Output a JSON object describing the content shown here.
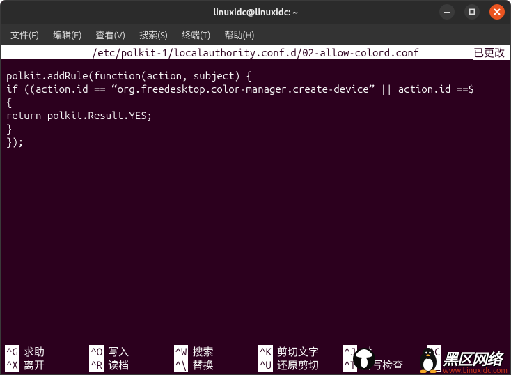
{
  "window": {
    "title": "linuxidc@linuxidc: ~"
  },
  "menubar": {
    "file": "文件(F)",
    "edit": "编辑(E)",
    "view": "查看(V)",
    "search": "搜索(S)",
    "terminal": "终端(T)",
    "help": "帮助(H)"
  },
  "nano": {
    "file_path": "/etc/polkit-1/localauthority.conf.d/02-allow-colord.conf",
    "status": "已更改"
  },
  "editor": {
    "content": "polkit.addRule(function(action, subject) {\nif ((action.id == “org.freedesktop.color-manager.create-device” || action.id ==$\n{\nreturn polkit.Result.YES;\n}\n});"
  },
  "shortcuts": {
    "g": {
      "key": "^G",
      "label": "求助"
    },
    "o": {
      "key": "^O",
      "label": "写入"
    },
    "w": {
      "key": "^W",
      "label": "搜索"
    },
    "k": {
      "key": "^K",
      "label": "剪切文字"
    },
    "j": {
      "key": "^J",
      "label": "对"
    },
    "c": {
      "key": "^C",
      "label": ""
    },
    "x": {
      "key": "^X",
      "label": "离开"
    },
    "r": {
      "key": "^R",
      "label": "读档"
    },
    "bs": {
      "key": "^\\",
      "label": "替换"
    },
    "u": {
      "key": "^U",
      "label": "还原剪切"
    },
    "t": {
      "key": "^T",
      "label": "拼写检查"
    },
    "und": {
      "key": "^_",
      "label": ""
    }
  },
  "watermark": {
    "brand1": "黑区",
    "brand2": "网络",
    "url": "www.Linuxidc.com"
  }
}
